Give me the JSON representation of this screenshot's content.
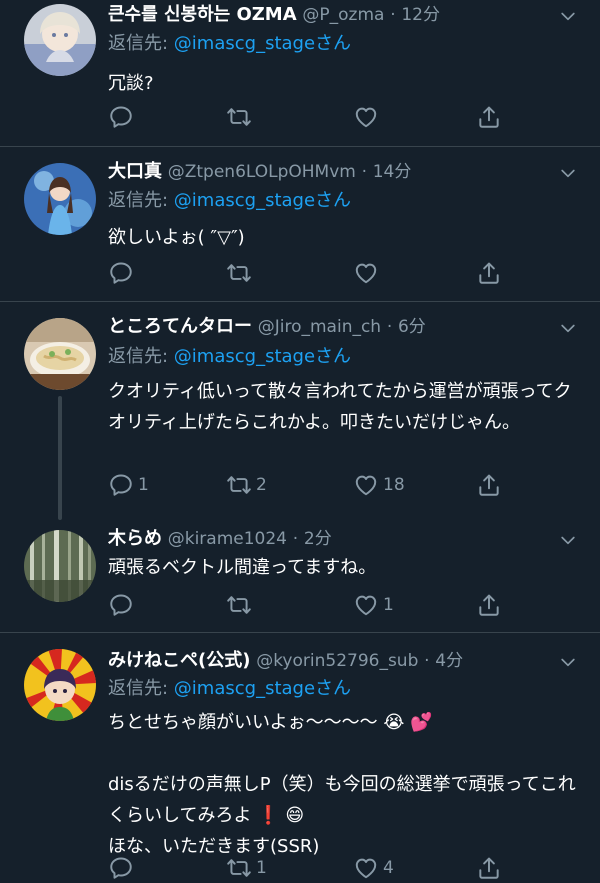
{
  "colors": {
    "background": "#15202b",
    "divider": "#38444d",
    "secondary_text": "#8899a6",
    "link": "#1da1f2",
    "primary_text": "#ffffff"
  },
  "tweets": [
    {
      "name": "큰수를 신봉하는 OZMA",
      "handle": "@P_ozma",
      "time": "12分",
      "reply_prefix": "返信先: ",
      "reply_handle": "@imascg_stageさん",
      "text": "冗談?",
      "reply_count": "",
      "retweet_count": "",
      "like_count": ""
    },
    {
      "name": "大口真",
      "handle": "@Ztpen6LOLpOHMvm",
      "time": "14分",
      "reply_prefix": "返信先: ",
      "reply_handle": "@imascg_stageさん",
      "text": "欲しいよぉ( ″▽″)",
      "reply_count": "",
      "retweet_count": "",
      "like_count": ""
    },
    {
      "name": "ところてんタロー",
      "handle": "@Jiro_main_ch",
      "time": "6分",
      "reply_prefix": "返信先: ",
      "reply_handle": "@imascg_stageさん",
      "text": "クオリティ低いって散々言われてたから運営が頑張ってクオリティ上げたらこれかよ。叩きたいだけじゃん。",
      "reply_count": "1",
      "retweet_count": "2",
      "like_count": "18"
    },
    {
      "name": "木らめ",
      "handle": "@kirame1024",
      "time": "2分",
      "text": "頑張るベクトル間違ってますね。",
      "reply_count": "",
      "retweet_count": "",
      "like_count": "1"
    },
    {
      "name": "みけねこペ(公式)",
      "handle": "@kyorin52796_sub",
      "time": "4分",
      "reply_prefix": "返信先: ",
      "reply_handle": "@imascg_stageさん",
      "text_line1": "ちとせちゃ顔がいいよぉ〜〜〜〜",
      "text_line2": "disるだけの声無しP（笑）も今回の総選挙で頑張ってこれくらいしてみろよ",
      "text_line3": "ほな、いただきます(SSR)",
      "emoji_1": "😭",
      "emoji_2": "💕",
      "emoji_3": "❗",
      "emoji_4": "😄",
      "reply_count": "",
      "retweet_count": "1",
      "like_count": "4"
    }
  ],
  "icons": {
    "reply": "reply-icon",
    "retweet": "retweet-icon",
    "like": "heart-icon",
    "share": "share-icon",
    "more": "chevron-down-icon"
  }
}
